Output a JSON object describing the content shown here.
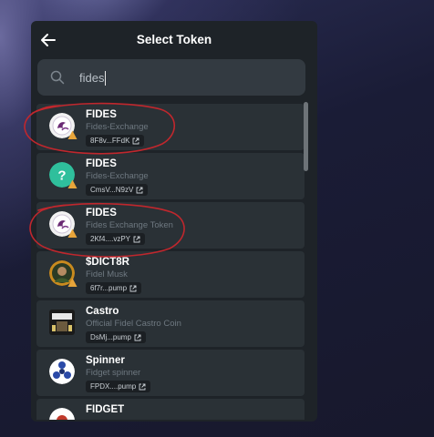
{
  "header": {
    "title": "Select Token"
  },
  "search": {
    "value": "fides"
  },
  "tokens": [
    {
      "symbol": "FIDES",
      "name": "Fides-Exchange",
      "address": "8F8v...FFdK"
    },
    {
      "symbol": "FIDES",
      "name": "Fides-Exchange",
      "address": "CmsV...N9zV"
    },
    {
      "symbol": "FIDES",
      "name": "Fides Exchange Token",
      "address": "2Kf4....vzPY"
    },
    {
      "symbol": "$DICT8R",
      "name": "Fidel Musk",
      "address": "6f7r...pump"
    },
    {
      "symbol": "Castro",
      "name": "Official Fidel Castro Coin",
      "address": "DsMj...pump"
    },
    {
      "symbol": "Spinner",
      "name": "Fidget spinner",
      "address": "FPDX....pump"
    },
    {
      "symbol": "FIDGET",
      "name": "",
      "address": ""
    }
  ],
  "colors": {
    "panel": "#1e2328",
    "row": "#2a3136",
    "search": "#333a41",
    "annotation": "#c0272d"
  },
  "icons": {
    "back": "arrow-left-icon",
    "search": "search-icon",
    "external": "external-link-icon"
  }
}
